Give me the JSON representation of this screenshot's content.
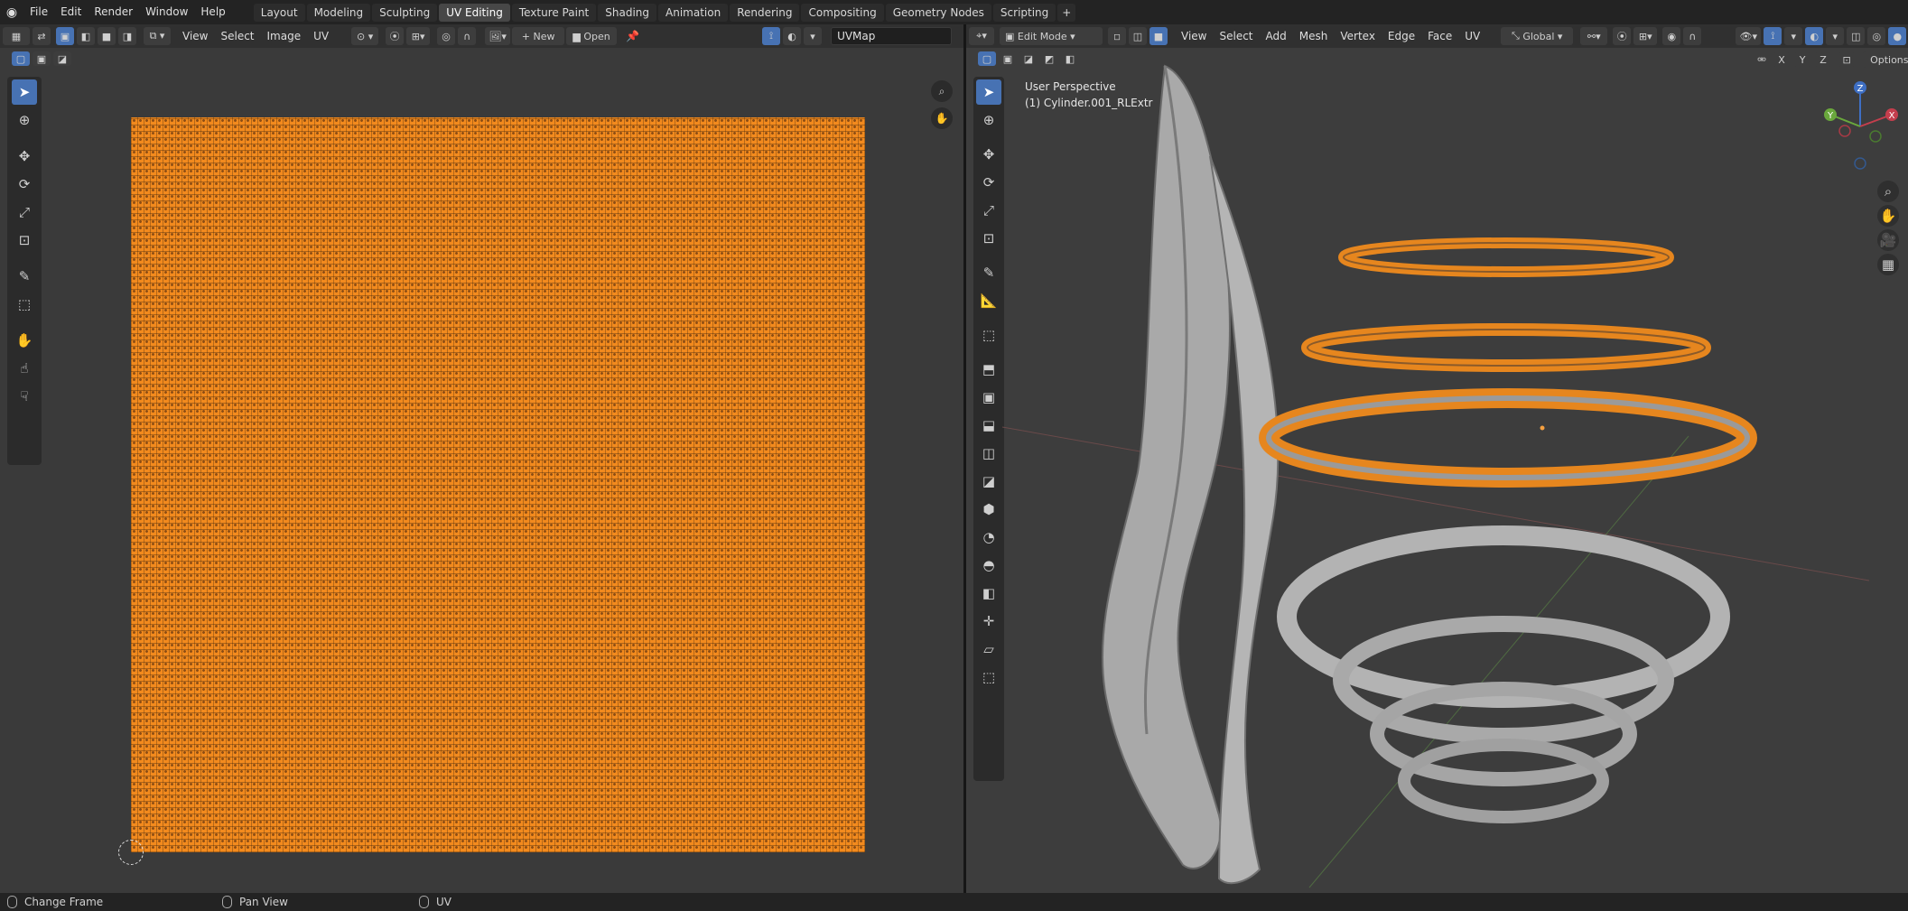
{
  "menubar": {
    "items": [
      "File",
      "Edit",
      "Render",
      "Window",
      "Help"
    ]
  },
  "workspaces": {
    "tabs": [
      "Layout",
      "Modeling",
      "Sculpting",
      "UV Editing",
      "Texture Paint",
      "Shading",
      "Animation",
      "Rendering",
      "Compositing",
      "Geometry Nodes",
      "Scripting"
    ],
    "active": "UV Editing"
  },
  "uv_editor": {
    "menus": [
      "View",
      "Select",
      "Image",
      "UV"
    ],
    "new_label": "New",
    "open_label": "Open",
    "uvmap_value": "UVMap"
  },
  "viewport": {
    "mode": "Edit Mode",
    "menus": [
      "View",
      "Select",
      "Add",
      "Mesh",
      "Vertex",
      "Edge",
      "Face",
      "UV"
    ],
    "transform_orientation": "Global",
    "options_label": "Options",
    "axis_x": "X",
    "axis_y": "Y",
    "axis_z": "Z",
    "overlay_line1": "User Perspective",
    "overlay_line2": "(1) Cylinder.001_RLExtr",
    "gizmo_x": "X",
    "gizmo_y": "Y",
    "gizmo_z": "Z"
  },
  "statusbar": {
    "change_frame": "Change Frame",
    "pan_view": "Pan View",
    "uv": "UV"
  },
  "colors": {
    "accent": "#4772b3",
    "uv_orange": "#f28a1e"
  },
  "icons": [
    "blender-logo-icon",
    "select-box-icon",
    "cursor-icon",
    "move-icon",
    "rotate-icon",
    "scale-icon",
    "transform-icon",
    "annotate-icon",
    "rip-icon",
    "grab-icon",
    "relax-icon",
    "pinch-icon",
    "zoom-icon",
    "hand-icon",
    "pin-icon",
    "camera-icon",
    "grid-icon"
  ]
}
